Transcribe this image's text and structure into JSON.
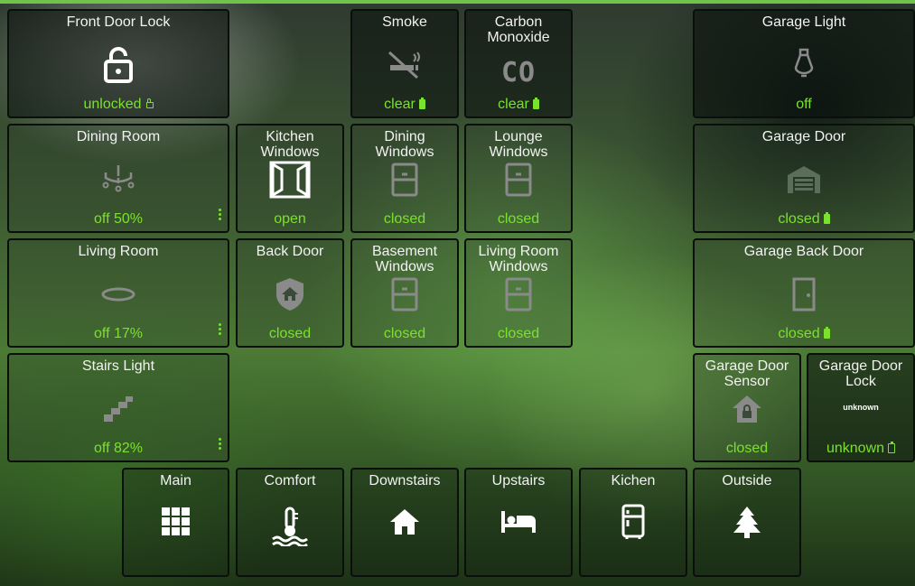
{
  "tiles": {
    "front_door_lock": {
      "title": "Front Door Lock",
      "state": "unlocked",
      "icon": "lock-open-icon"
    },
    "smoke": {
      "title": "Smoke",
      "state": "clear",
      "icon": "smoke-off-icon"
    },
    "carbon_monoxide": {
      "title": "Carbon Monoxide",
      "state": "clear",
      "icon": "co-icon",
      "icon_text": "CO"
    },
    "garage_light": {
      "title": "Garage Light",
      "state": "off",
      "icon": "bulb-icon"
    },
    "dining_room": {
      "title": "Dining Room",
      "state": "off 50%",
      "icon": "chandelier-icon"
    },
    "kitchen_windows": {
      "title": "Kitchen Windows",
      "state": "open",
      "icon": "window-open-icon"
    },
    "dining_windows": {
      "title": "Dining Windows",
      "state": "closed",
      "icon": "window-closed-icon"
    },
    "lounge_windows": {
      "title": "Lounge Windows",
      "state": "closed",
      "icon": "window-closed-icon"
    },
    "garage_door": {
      "title": "Garage Door",
      "state": "closed",
      "icon": "garage-icon"
    },
    "living_room": {
      "title": "Living Room",
      "state": "off 17%",
      "icon": "ceiling-light-icon"
    },
    "back_door": {
      "title": "Back Door",
      "state": "closed",
      "icon": "shield-home-icon"
    },
    "basement_windows": {
      "title": "Basement Windows",
      "state": "closed",
      "icon": "window-closed-icon"
    },
    "living_room_windows": {
      "title": "Living Room Windows",
      "state": "closed",
      "icon": "window-closed-icon"
    },
    "garage_back_door": {
      "title": "Garage Back Door",
      "state": "closed",
      "icon": "door-icon"
    },
    "stairs_light": {
      "title": "Stairs Light",
      "state": "off 82%",
      "icon": "stairs-icon"
    },
    "garage_door_sensor": {
      "title": "Garage Door Sensor",
      "state": "closed",
      "icon": "home-lock-icon"
    },
    "garage_door_lock": {
      "title": "Garage Door Lock",
      "state": "unknown",
      "icon": "unknown-icon",
      "icon_text": "unknown"
    }
  },
  "nav": {
    "main": {
      "title": "Main",
      "icon": "grid-icon"
    },
    "comfort": {
      "title": "Comfort",
      "icon": "thermometer-water-icon"
    },
    "downstairs": {
      "title": "Downstairs",
      "icon": "home-icon"
    },
    "upstairs": {
      "title": "Upstairs",
      "icon": "bed-icon"
    },
    "kichen": {
      "title": "Kichen",
      "icon": "fridge-icon"
    },
    "outside": {
      "title": "Outside",
      "icon": "pine-tree-icon"
    }
  },
  "colors": {
    "state": "#7be12e",
    "border": "#0b0f0b",
    "accent_bar": "#6fc24a"
  }
}
